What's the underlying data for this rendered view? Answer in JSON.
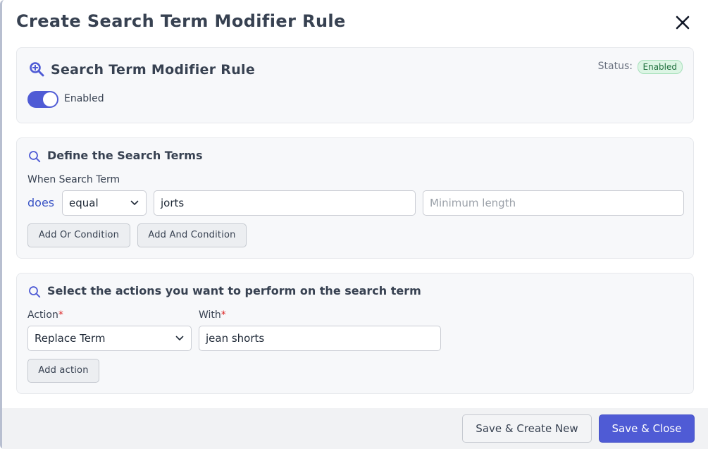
{
  "modal": {
    "title": "Create Search Term Modifier Rule",
    "close_icon": "close-icon"
  },
  "rule_card": {
    "icon": "search-plus-icon",
    "title": "Search Term Modifier Rule",
    "status_label": "Status:",
    "status_badge": "Enabled",
    "toggle_on": true,
    "toggle_label": "Enabled"
  },
  "terms_card": {
    "icon": "search-icon",
    "title": "Define the Search Terms",
    "when_label": "When Search Term",
    "does_text": "does",
    "operator_value": "equal",
    "term_value": "jorts",
    "min_length_placeholder": "Minimum length",
    "add_or_label": "Add Or Condition",
    "add_and_label": "Add And Condition"
  },
  "actions_card": {
    "icon": "search-icon",
    "title": "Select the actions you want to perform on the search term",
    "action_label": "Action",
    "with_label": "With",
    "required_mark": "*",
    "action_value": "Replace Term",
    "with_value": "jean shorts",
    "add_action_label": "Add action"
  },
  "footer": {
    "save_create_new_label": "Save & Create New",
    "save_close_label": "Save & Close"
  },
  "colors": {
    "primary": "#4f5bd5",
    "does_text": "#3b55c6",
    "required": "#dc2626",
    "status_badge_bg": "#dcf5e4"
  }
}
